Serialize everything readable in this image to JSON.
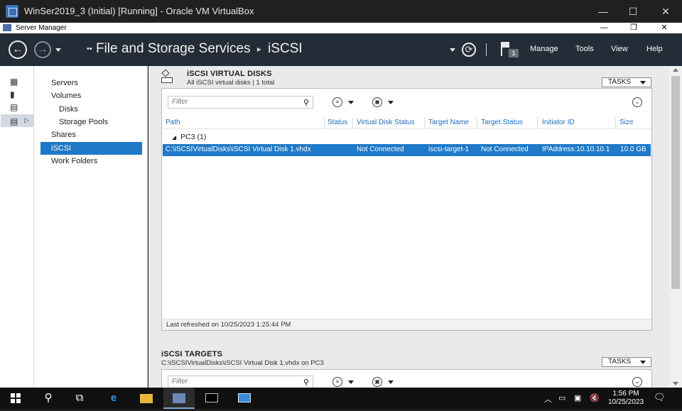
{
  "vbox": {
    "title": "WinSer2019_3 (Initial) [Running] - Oracle VM VirtualBox",
    "min": "—",
    "max": "☐",
    "close": "✕"
  },
  "sm": {
    "title": "Server Manager",
    "min": "—",
    "restore": "❐",
    "close": "✕"
  },
  "header": {
    "back_glyph": "←",
    "forward_glyph": "→",
    "crumb_arrows": "••",
    "crumb_root": "File and Storage Services",
    "crumb_sep": "▸",
    "crumb_leaf": "iSCSI",
    "refresh_glyph": "⟳",
    "notif_count": "1",
    "menu": [
      "Manage",
      "Tools",
      "View",
      "Help"
    ]
  },
  "nav": {
    "items": [
      {
        "label": "Servers",
        "sub": false,
        "selected": false
      },
      {
        "label": "Volumes",
        "sub": false,
        "selected": false
      },
      {
        "label": "Disks",
        "sub": true,
        "selected": false
      },
      {
        "label": "Storage Pools",
        "sub": true,
        "selected": false
      },
      {
        "label": "Shares",
        "sub": false,
        "selected": false
      },
      {
        "label": "iSCSI",
        "sub": false,
        "selected": true
      },
      {
        "label": "Work Folders",
        "sub": false,
        "selected": false
      }
    ]
  },
  "disks": {
    "title": "iSCSI VIRTUAL DISKS",
    "subtitle": "All iSCSI virtual disks | 1 total",
    "tasks": "TASKS",
    "filter_placeholder": "Filter",
    "columns": [
      "Path",
      "Status",
      "Virtual Disk Status",
      "Target Name",
      "Target Status",
      "Initiator ID",
      "Size"
    ],
    "group": "PC3 (1)",
    "row": [
      "C:\\iSCSIVirtualDisks\\iSCSI Virtual Disk 1.vhdx",
      "",
      "Not Connected",
      "iscsi-target-1",
      "Not Connected",
      "IPAddress:10.10.10.1",
      "10.0 GB"
    ],
    "refreshed": "Last refreshed on 10/25/2023 1:25:44 PM"
  },
  "targets": {
    "title": "iSCSI TARGETS",
    "subtitle": "C:\\iSCSIVirtualDisks\\iSCSI Virtual Disk 1.vhdx on PC3",
    "tasks": "TASKS",
    "filter_placeholder": "Filter"
  },
  "taskbar": {
    "time": "1:56 PM",
    "date": "10/25/2023"
  },
  "colors": {
    "accent": "#1e79c8",
    "header_bg": "#242c37"
  }
}
